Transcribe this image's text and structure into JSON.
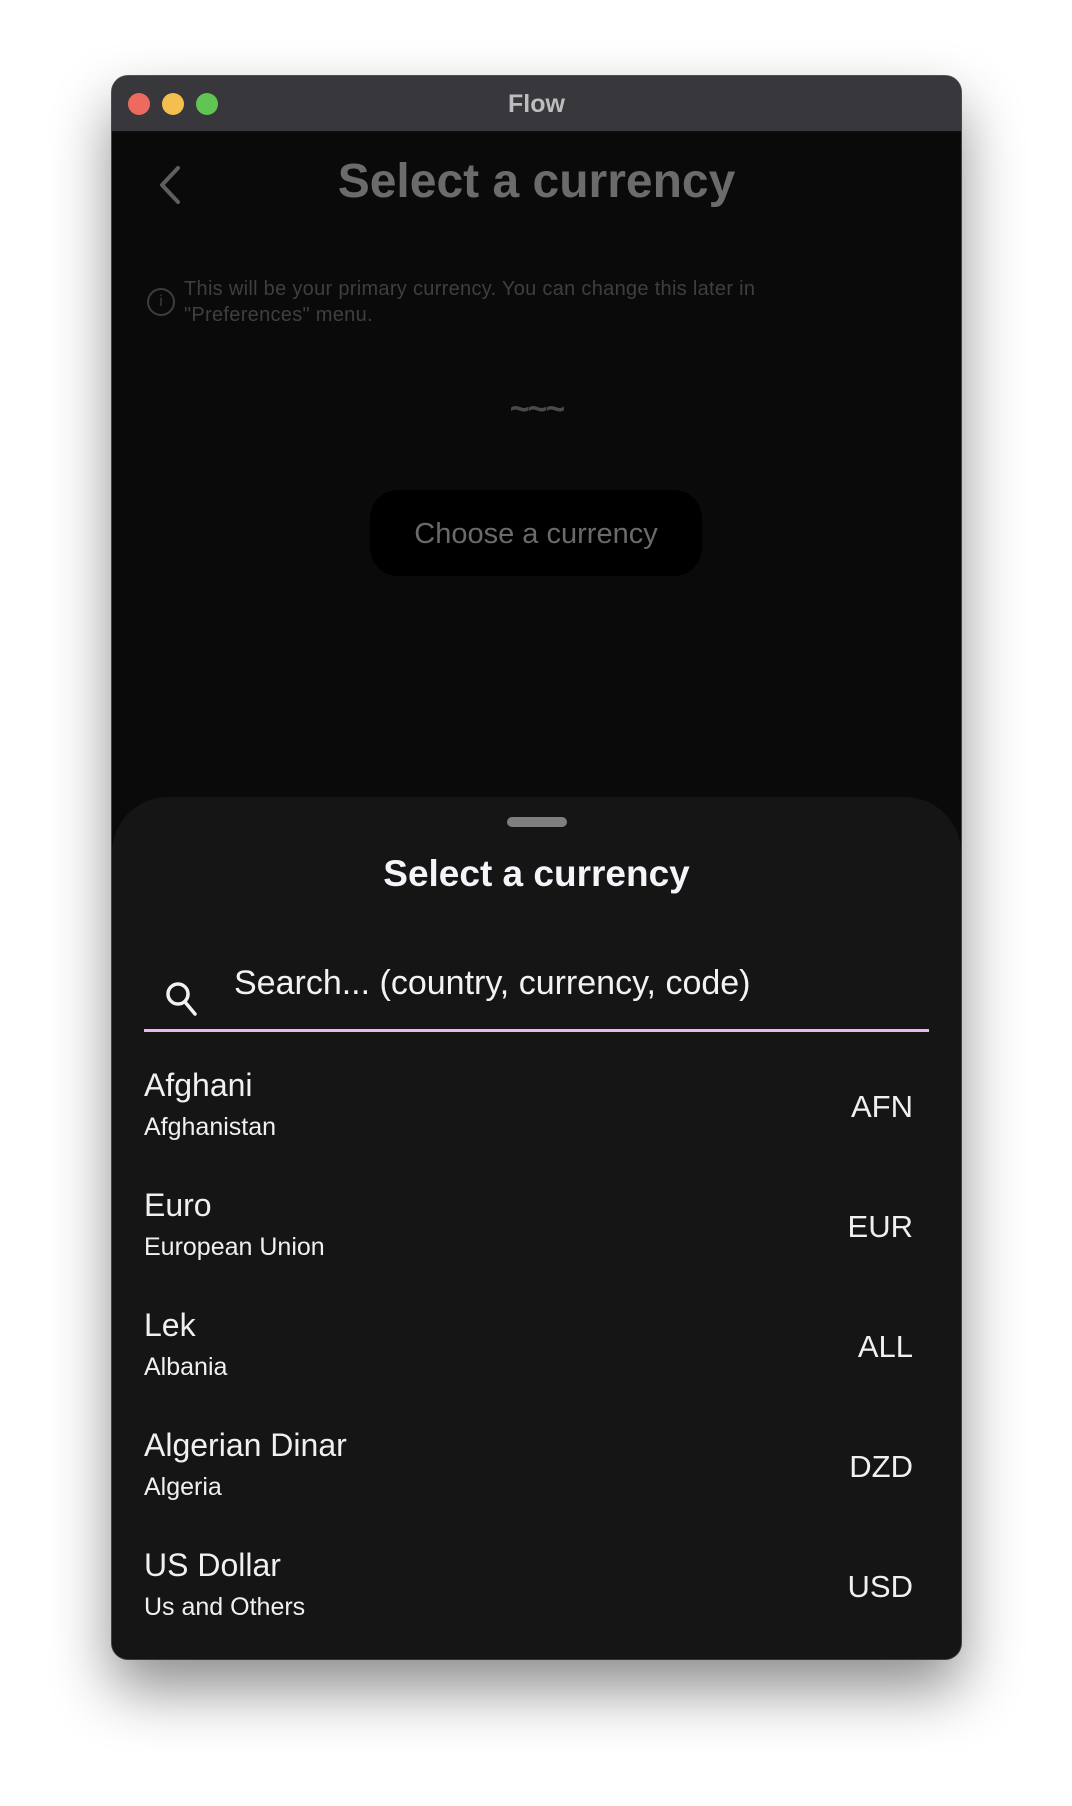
{
  "window": {
    "title": "Flow",
    "lights": {
      "close": "#ed6a5e",
      "minimize": "#f5bf4f",
      "zoom": "#61c554"
    }
  },
  "page": {
    "title": "Select a currency",
    "info": "This will be your primary currency. You can change this later in \"Preferences\" menu.",
    "placeholder_symbol": "~~~",
    "choose_button": "Choose a currency"
  },
  "sheet": {
    "title": "Select a currency",
    "search_placeholder": "Search... (country, currency, code)",
    "accent": "#e5b8f4",
    "items": [
      {
        "name": "Afghani",
        "country": "Afghanistan",
        "code": "AFN"
      },
      {
        "name": "Euro",
        "country": "European Union",
        "code": "EUR"
      },
      {
        "name": "Lek",
        "country": "Albania",
        "code": "ALL"
      },
      {
        "name": "Algerian Dinar",
        "country": "Algeria",
        "code": "DZD"
      },
      {
        "name": "US Dollar",
        "country": "Us and Others",
        "code": "USD"
      }
    ]
  }
}
